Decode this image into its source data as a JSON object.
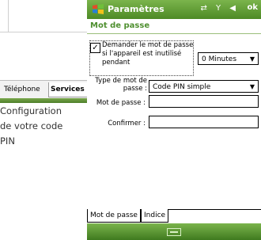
{
  "background": {
    "tabs": [
      "Téléphone",
      "Services"
    ]
  },
  "caption": {
    "lines": [
      "Configuration",
      "de votre code",
      "PIN"
    ]
  },
  "titlebar": {
    "title": "Paramètres",
    "ok": "ok",
    "status_icons": "⇄ Y ◀"
  },
  "screen": {
    "header": "Mot de passe",
    "checkbox": {
      "checked": true,
      "label": "Demander le mot de passe si l'appareil est inutilisé pendant"
    },
    "timeout_select": "0 Minutes",
    "type_label": "Type de mot de passe :",
    "type_select": "Code PIN simple",
    "password_label": "Mot de passe :",
    "confirm_label": "Confirmer :",
    "password_value": "",
    "confirm_value": ""
  },
  "tabs": [
    "Mot de passe",
    "Indice"
  ],
  "colors": {
    "accent_green": "#4d8a25",
    "header_text": "#4e8f2f"
  }
}
